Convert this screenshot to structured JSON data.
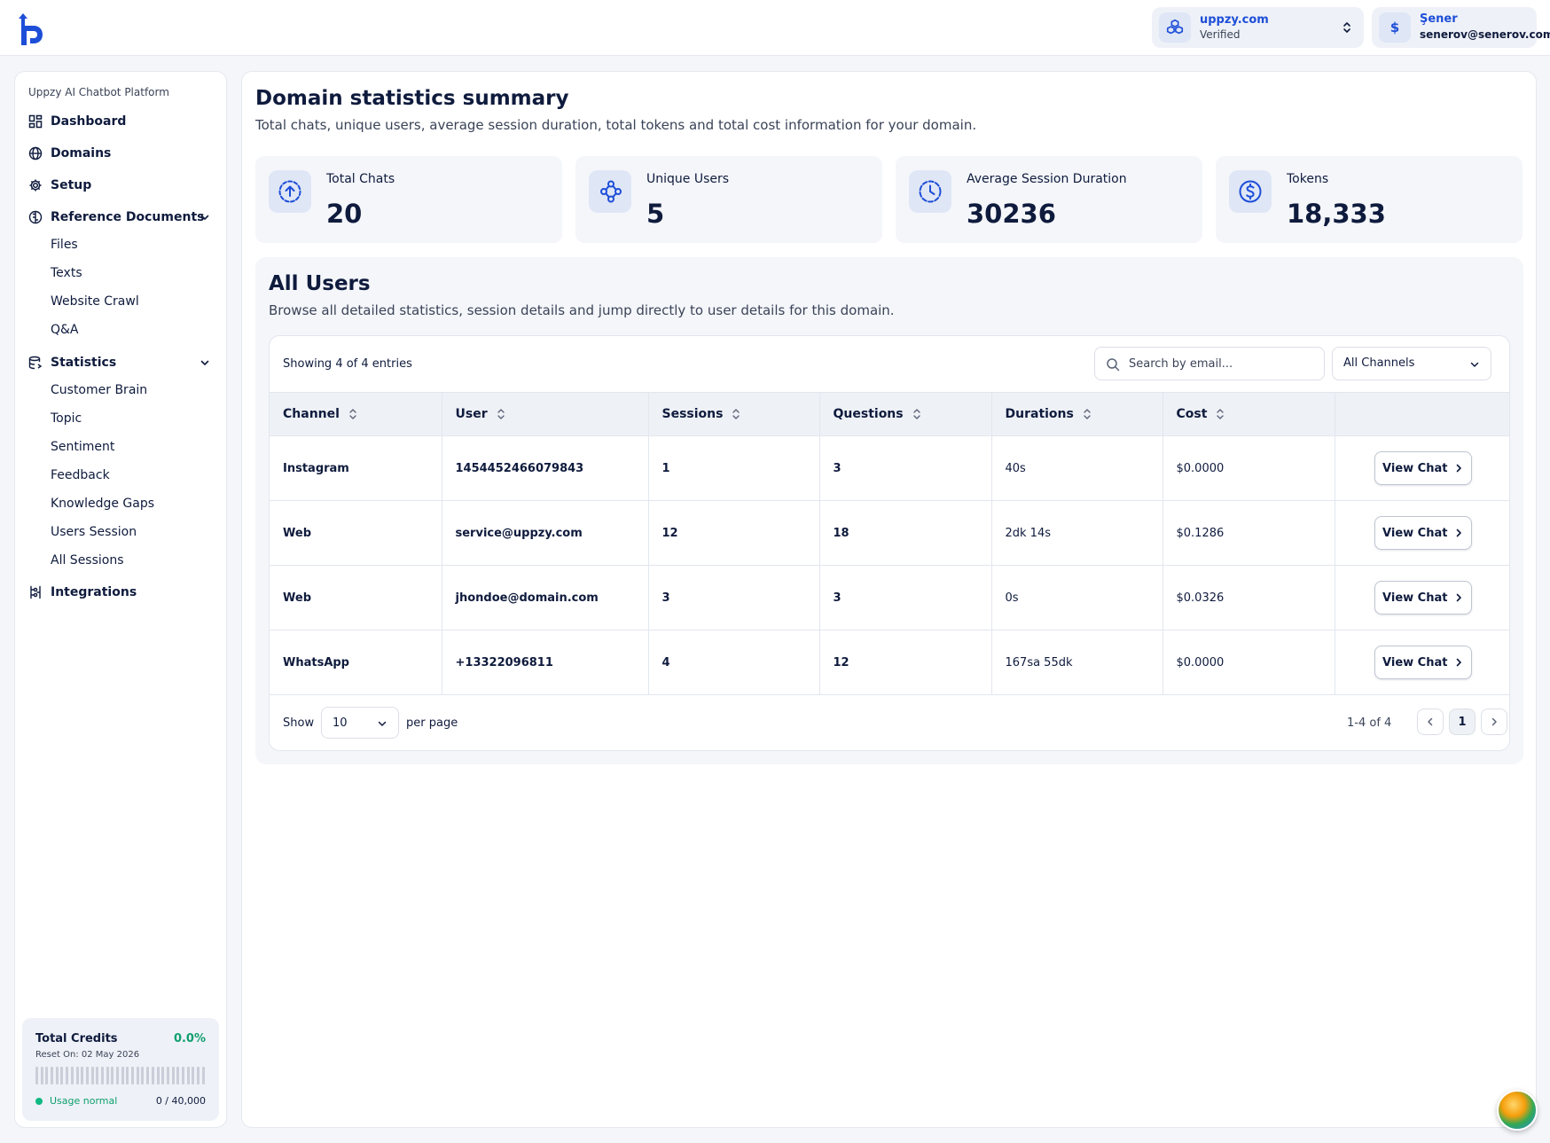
{
  "header": {
    "domain_name": "uppzy.com",
    "domain_status": "Verified",
    "user_name": "Şener",
    "user_email": "senerov@senerov.com",
    "user_initial": "$"
  },
  "sidebar": {
    "caption": "Uppzy AI Chatbot Platform",
    "dashboard": "Dashboard",
    "domains": "Domains",
    "setup": "Setup",
    "reference_documents": "Reference Documents",
    "reference_items": [
      "Files",
      "Texts",
      "Website Crawl",
      "Q&A"
    ],
    "statistics": "Statistics",
    "statistics_items": [
      "Customer Brain",
      "Topic",
      "Sentiment",
      "Feedback",
      "Knowledge Gaps",
      "Users Session",
      "All Sessions"
    ],
    "integrations": "Integrations",
    "credits": {
      "title": "Total Credits",
      "percent": "0.0%",
      "reset": "Reset On: 02 May 2026",
      "status": "Usage normal",
      "usage": "0 / 40,000",
      "fill": 0.0
    }
  },
  "summary": {
    "title": "Domain statistics summary",
    "subtitle": "Total chats, unique users, average session duration, total tokens and total cost information for your domain.",
    "cards": [
      {
        "label": "Total Chats",
        "value": "20",
        "icon": "arrow-up-circle-icon"
      },
      {
        "label": "Unique Users",
        "value": "5",
        "icon": "share-nodes-icon"
      },
      {
        "label": "Average Session Duration",
        "value": "30236",
        "icon": "clock-icon"
      },
      {
        "label": "Tokens",
        "value": "18,333",
        "icon": "dollar-circle-icon"
      }
    ]
  },
  "users": {
    "title": "All Users",
    "subtitle": "Browse all detailed statistics, session details and jump directly to user details for this domain.",
    "showing": "Showing 4 of 4 entries",
    "search_placeholder": "Search by email...",
    "channel_filter": "All Channels",
    "columns": [
      "Channel",
      "User",
      "Sessions",
      "Questions",
      "Durations",
      "Cost"
    ],
    "rows": [
      {
        "channel": "Instagram",
        "user": "1454452466079843",
        "sessions": "1",
        "questions": "3",
        "duration": "40s",
        "cost": "$0.0000",
        "action": "View Chat"
      },
      {
        "channel": "Web",
        "user": "service@uppzy.com",
        "sessions": "12",
        "questions": "18",
        "duration": "2dk 14s",
        "cost": "$0.1286",
        "action": "View Chat"
      },
      {
        "channel": "Web",
        "user": "jhondoe@domain.com",
        "sessions": "3",
        "questions": "3",
        "duration": "0s",
        "cost": "$0.0326",
        "action": "View Chat"
      },
      {
        "channel": "WhatsApp",
        "user": "+13322096811",
        "sessions": "4",
        "questions": "12",
        "duration": "167sa 55dk",
        "cost": "$0.0000",
        "action": "View Chat"
      }
    ],
    "pager": {
      "show": "Show",
      "per_page_value": "10",
      "per_page": "per page",
      "range": "1-4 of 4",
      "current_page": "1"
    }
  },
  "colors": {
    "accent": "#1d4ed8",
    "success": "#0e9f6e",
    "background": "#f4f6fa"
  }
}
